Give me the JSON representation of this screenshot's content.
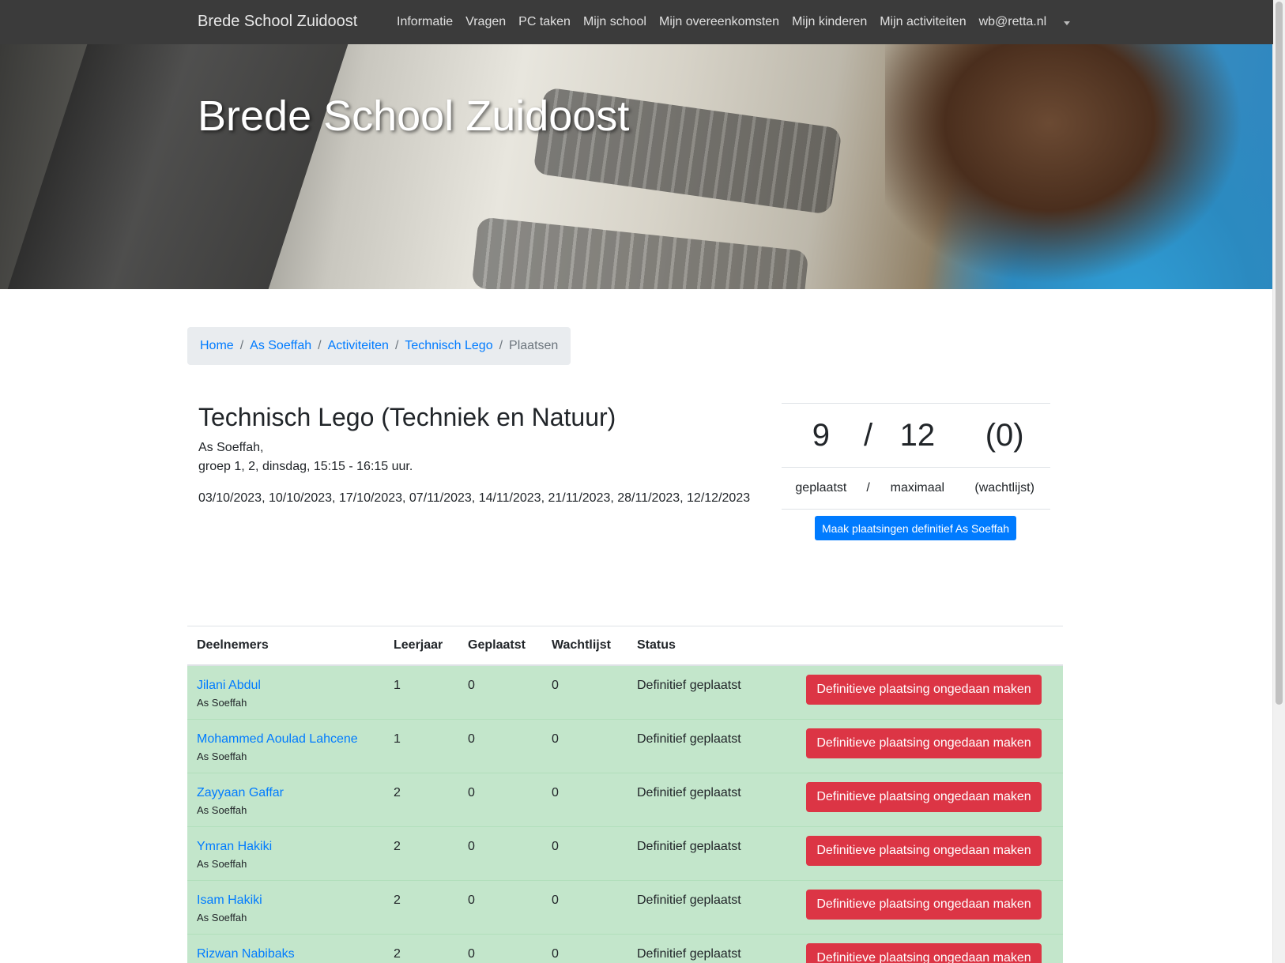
{
  "navbar": {
    "brand": "Brede School Zuidoost",
    "items": [
      "Informatie",
      "Vragen",
      "PC taken",
      "Mijn school",
      "Mijn overeenkomsten",
      "Mijn kinderen",
      "Mijn activiteiten",
      "wb@retta.nl"
    ]
  },
  "hero": {
    "title": "Brede School Zuidoost"
  },
  "breadcrumb": {
    "home": "Home",
    "school": "As Soeffah",
    "activities": "Activiteiten",
    "activity": "Technisch Lego",
    "current": "Plaatsen",
    "separator": "/"
  },
  "activity": {
    "title": "Technisch Lego (Techniek en Natuur)",
    "school_line": "As Soeffah,",
    "schedule_line": "groep 1, 2, dinsdag, 15:15 - 16:15 uur.",
    "dates": "03/10/2023, 10/10/2023, 17/10/2023, 07/11/2023, 14/11/2023, 21/11/2023, 28/11/2023, 12/12/2023"
  },
  "stats": {
    "placed": "9",
    "slash": "/",
    "max": "12",
    "waitlist": "(0)",
    "placed_label": "geplaatst",
    "max_label": "maximaal",
    "waitlist_label": "(wachtlijst)"
  },
  "finalize_button": "Maak plaatsingen definitief As Soeffah",
  "table": {
    "headers": [
      "Deelnemers",
      "Leerjaar",
      "Geplaatst",
      "Wachtlijst",
      "Status"
    ],
    "undo_label": "Definitieve plaatsing ongedaan maken",
    "rows": [
      {
        "name": "Jilani Abdul",
        "school": "As Soeffah",
        "grade": "1",
        "placed": "0",
        "waitlist": "0",
        "status": "Definitief geplaatst"
      },
      {
        "name": "Mohammed Aoulad Lahcene",
        "school": "As Soeffah",
        "grade": "1",
        "placed": "0",
        "waitlist": "0",
        "status": "Definitief geplaatst"
      },
      {
        "name": "Zayyaan Gaffar",
        "school": "As Soeffah",
        "grade": "2",
        "placed": "0",
        "waitlist": "0",
        "status": "Definitief geplaatst"
      },
      {
        "name": "Ymran Hakiki",
        "school": "As Soeffah",
        "grade": "2",
        "placed": "0",
        "waitlist": "0",
        "status": "Definitief geplaatst"
      },
      {
        "name": "Isam Hakiki",
        "school": "As Soeffah",
        "grade": "2",
        "placed": "0",
        "waitlist": "0",
        "status": "Definitief geplaatst"
      },
      {
        "name": "Rizwan Nabibaks",
        "school": "",
        "grade": "2",
        "placed": "0",
        "waitlist": "0",
        "status": "Definitief geplaatst"
      }
    ]
  },
  "colors": {
    "navbar": "#3b3b3b",
    "link": "#007bff",
    "danger": "#dc3545",
    "success_row": "#c3e6cb"
  }
}
